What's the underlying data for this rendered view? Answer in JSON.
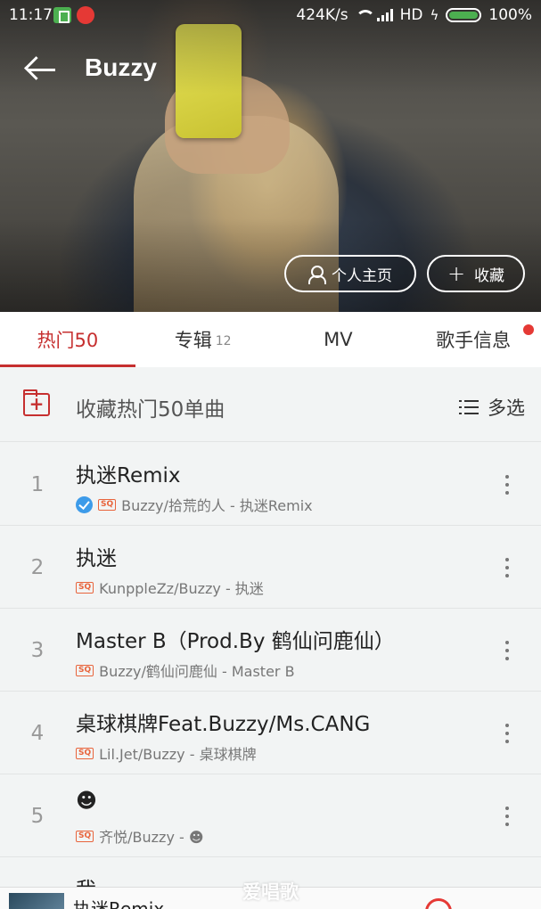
{
  "status_bar": {
    "time": "11:17",
    "net_speed": "424K/s",
    "network": "HD",
    "battery": "100%"
  },
  "header": {
    "artist_name": "Buzzy",
    "home_button_label": "个人主页",
    "collect_button_label": "收藏"
  },
  "tabs": [
    {
      "label": "热门50",
      "count": "",
      "active": true
    },
    {
      "label": "专辑",
      "count": "12",
      "active": false
    },
    {
      "label": "MV",
      "count": "",
      "active": false
    },
    {
      "label": "歌手信息",
      "count": "",
      "active": false,
      "badge": true
    }
  ],
  "actions": {
    "collect_all_label": "收藏热门50单曲",
    "multi_select_label": "多选"
  },
  "songs": [
    {
      "num": "1",
      "title": "执迷Remix",
      "subtitle": "Buzzy/拾荒的人 - 执迷Remix",
      "verified": true,
      "quality": "SQ"
    },
    {
      "num": "2",
      "title": "执迷",
      "subtitle": "KunppleZz/Buzzy - 执迷",
      "verified": false,
      "quality": "SQ"
    },
    {
      "num": "3",
      "title": "Master B（Prod.By 鹤仙问鹿仙）",
      "subtitle": "Buzzy/鹤仙问鹿仙 - Master B",
      "verified": false,
      "quality": "SQ"
    },
    {
      "num": "4",
      "title": "桌球棋牌Feat.Buzzy/Ms.CANG",
      "subtitle": "Lil.Jet/Buzzy - 桌球棋牌",
      "verified": false,
      "quality": "SQ"
    },
    {
      "num": "5",
      "title": "☻",
      "subtitle": "齐悦/Buzzy - ☻",
      "verified": false,
      "quality": "SQ"
    },
    {
      "num": "",
      "title": "我",
      "subtitle": "",
      "verified": false,
      "quality": ""
    }
  ],
  "player": {
    "now_playing": "执迷Remix"
  },
  "watermark": "爱唱歌",
  "colors": {
    "accent": "#c62f2f",
    "verified": "#3d9be9",
    "sq_badge": "#e8643c",
    "battery": "#4caf50"
  }
}
